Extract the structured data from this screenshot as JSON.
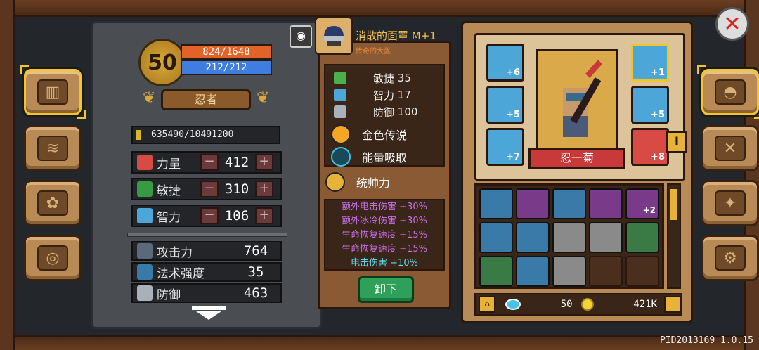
{
  "player": {
    "level": "50",
    "hp": "824/1648",
    "mp": "212/212",
    "class": "忍者",
    "xp": "635490/10491200",
    "xp_fraction": 0.06
  },
  "attributes": [
    {
      "label": "力量",
      "value": "412",
      "color": "#d84a44"
    },
    {
      "label": "敏捷",
      "value": "310",
      "color": "#3a9a44"
    },
    {
      "label": "智力",
      "value": "106",
      "color": "#4ca6d8"
    }
  ],
  "derived": [
    {
      "label": "攻击力",
      "value": "764"
    },
    {
      "label": "法术强度",
      "value": "35"
    },
    {
      "label": "防御",
      "value": "463"
    }
  ],
  "item": {
    "name": "消散的面罩 M+1",
    "subtitle": "传奇的大盔",
    "stats": [
      {
        "label": "敏捷",
        "value": "35",
        "color": "#4ab04a"
      },
      {
        "label": "智力",
        "value": "17",
        "color": "#4ca6d8"
      },
      {
        "label": "防御",
        "value": "100",
        "color": "#aab0b8"
      }
    ],
    "skills": [
      {
        "label": "金色传说",
        "color": "#f5a623"
      },
      {
        "label": "能量吸取",
        "color": "#3ac2e8"
      },
      {
        "label": "统帅力",
        "color": "#e6b23a"
      }
    ],
    "bonuses": [
      {
        "text": "额外电击伤害 +30%",
        "style": "purple"
      },
      {
        "text": "额外冰冷伤害 +30%",
        "style": "purple"
      },
      {
        "text": "生命恢复速度 +15%",
        "style": "purple"
      },
      {
        "text": "生命恢复速度 +15%",
        "style": "purple"
      },
      {
        "text": "电击伤害 +10%",
        "style": "teal"
      }
    ],
    "unequip_label": "卸下"
  },
  "equipment": {
    "character_name": "忍一菊",
    "slots": [
      {
        "badge": "+6",
        "color": "blue"
      },
      {
        "badge": "+5",
        "color": "blue"
      },
      {
        "badge": "+7",
        "color": "blue"
      },
      {
        "badge": "+1",
        "color": "blue"
      },
      {
        "badge": "+5",
        "color": "blue"
      },
      {
        "badge": "+8",
        "color": "red"
      }
    ],
    "ribbon_tag": "I"
  },
  "inventory": {
    "rows": [
      [
        {
          "color": "blue",
          "lock": true,
          "badge": ""
        },
        {
          "color": "purple",
          "lock": true,
          "badge": ""
        },
        {
          "color": "blue",
          "lock": true,
          "badge": ""
        },
        {
          "color": "purple",
          "lock": true,
          "badge": ""
        },
        {
          "color": "purple",
          "lock": false,
          "badge": "+2"
        }
      ],
      [
        {
          "color": "blue",
          "lock": false,
          "badge": ""
        },
        {
          "color": "blue",
          "lock": false,
          "badge": ""
        },
        {
          "color": "gray",
          "lock": false,
          "badge": ""
        },
        {
          "color": "gray",
          "lock": false,
          "badge": ""
        },
        {
          "color": "green",
          "lock": false,
          "badge": ""
        }
      ],
      [
        {
          "color": "green",
          "lock": false,
          "badge": ""
        },
        {
          "color": "blue",
          "lock": false,
          "badge": ""
        },
        {
          "color": "gray",
          "lock": false,
          "badge": ""
        },
        {
          "color": "empty",
          "lock": false,
          "badge": ""
        },
        {
          "color": "empty",
          "lock": false,
          "badge": ""
        }
      ]
    ]
  },
  "resources": {
    "gems": "50",
    "gold": "421K"
  },
  "version": "PID2013169 1.0.15"
}
